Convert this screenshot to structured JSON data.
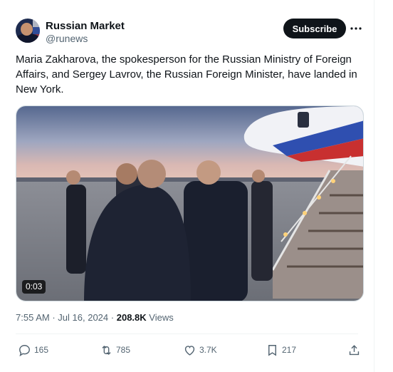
{
  "post": {
    "author_name": "Russian Market",
    "handle": "@runews",
    "subscribe_label": "Subscribe",
    "text": "Maria Zakharova, the spokesperson for the Russian Ministry of Foreign Affairs, and Sergey Lavrov, the Russian Foreign Minister, have landed in New York.",
    "video_duration": "0:03",
    "time": "7:55 AM",
    "separator": "·",
    "date": "Jul 16, 2024",
    "view_count": "208.8K",
    "views_label": "Views"
  },
  "actions": {
    "replies": "165",
    "reposts": "785",
    "likes": "3.7K",
    "bookmarks": "217"
  },
  "colors": {
    "text_primary": "#0f1419",
    "text_secondary": "#536471",
    "button_dark": "#0f1419"
  },
  "icons": [
    "more-icon",
    "reply-icon",
    "repost-icon",
    "like-icon",
    "bookmark-icon",
    "share-icon"
  ]
}
